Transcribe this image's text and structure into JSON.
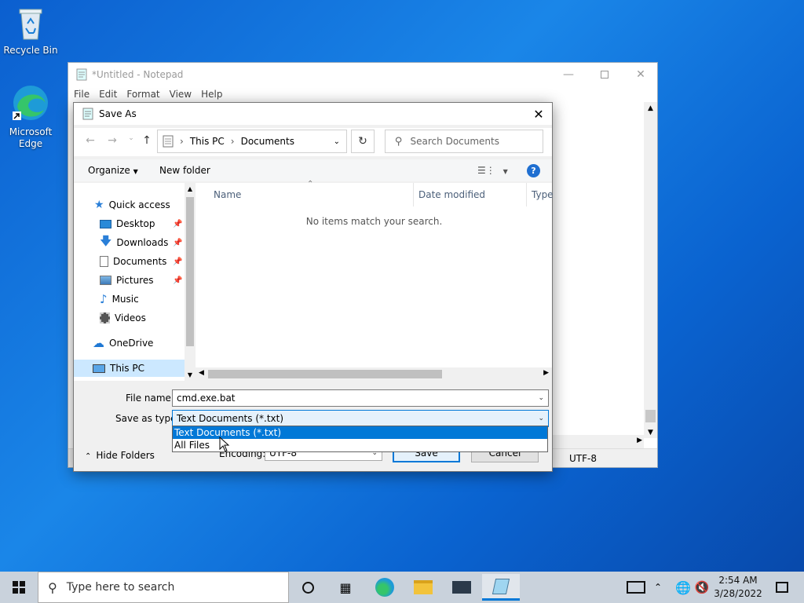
{
  "desktop": {
    "icons": [
      {
        "label": "Recycle Bin"
      },
      {
        "label": "Microsoft Edge"
      }
    ]
  },
  "notepad": {
    "title": "*Untitled - Notepad",
    "menu": [
      "File",
      "Edit",
      "Format",
      "View",
      "Help"
    ],
    "status_encoding": "UTF-8"
  },
  "dialog": {
    "title": "Save As",
    "breadcrumb": [
      "This PC",
      "Documents"
    ],
    "search_placeholder": "Search Documents",
    "organize_label": "Organize",
    "new_folder_label": "New folder",
    "tree": {
      "quick_access": "Quick access",
      "items": [
        "Desktop",
        "Downloads",
        "Documents",
        "Pictures",
        "Music",
        "Videos"
      ],
      "onedrive": "OneDrive",
      "this_pc": "This PC"
    },
    "columns": [
      "Name",
      "Date modified",
      "Type"
    ],
    "empty_message": "No items match your search.",
    "file_name_label": "File name:",
    "file_name_value": "cmd.exe.bat",
    "save_as_type_label": "Save as type:",
    "save_as_type_value": "Text Documents (*.txt)",
    "type_options": [
      "Text Documents (*.txt)",
      "All Files"
    ],
    "hide_folders_label": "Hide Folders",
    "encoding_label": "Encoding:",
    "encoding_value": "UTF-8",
    "save_label": "Save",
    "cancel_label": "Cancel"
  },
  "taskbar": {
    "search_placeholder": "Type here to search",
    "time": "2:54 AM",
    "date": "3/28/2022"
  },
  "colors": {
    "accent": "#0078d7",
    "taskbar_bg": "#c9d2dc"
  }
}
